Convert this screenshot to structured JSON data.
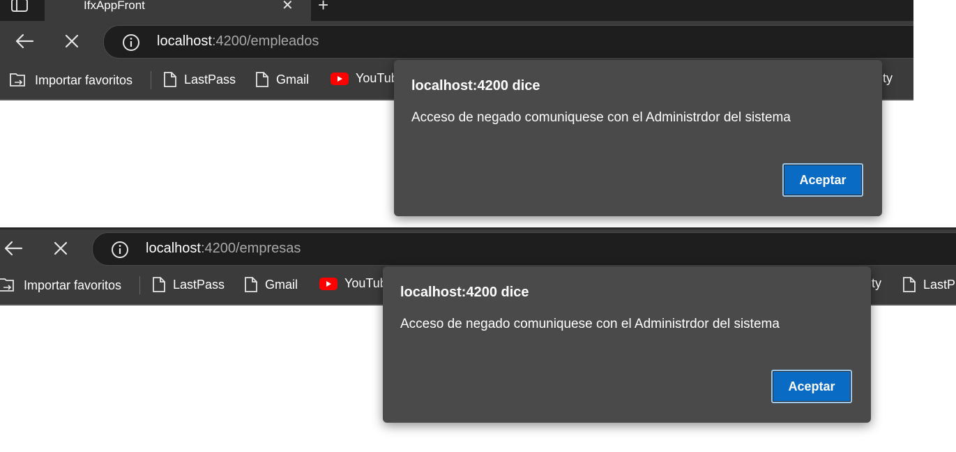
{
  "screen1": {
    "tab": {
      "title": "IfxAppFront"
    },
    "address": {
      "host": "localhost",
      "path": ":4200/empleados"
    },
    "bookmarks": [
      {
        "label": "Importar favoritos",
        "icon": "import-favorites-icon"
      },
      {
        "label": "LastPass",
        "icon": "page-icon"
      },
      {
        "label": "Gmail",
        "icon": "page-icon"
      },
      {
        "label": "YouTube",
        "icon": "youtube-icon"
      },
      {
        "label": "ity",
        "icon": ""
      }
    ],
    "dialog": {
      "title": "localhost:4200 dice",
      "message": "Acceso de negado comuniquese con el Administrdor del sistema",
      "ok_label": "Aceptar"
    }
  },
  "screen2": {
    "address": {
      "host": "localhost",
      "path": ":4200/empresas"
    },
    "bookmarks": [
      {
        "label": "Importar favoritos",
        "icon": "import-favorites-icon"
      },
      {
        "label": "LastPass",
        "icon": "page-icon"
      },
      {
        "label": "Gmail",
        "icon": "page-icon"
      },
      {
        "label": "YouTube",
        "icon": "youtube-icon"
      },
      {
        "label": "ity",
        "icon": ""
      },
      {
        "label": "LastP",
        "icon": "page-icon"
      }
    ],
    "dialog": {
      "title": "localhost:4200 dice",
      "message": "Acceso de negado comuniquese con el Administrdor del sistema",
      "ok_label": "Aceptar"
    }
  },
  "colors": {
    "chrome": "#3b3b3b",
    "dialog": "#4a4a4a",
    "accent": "#0a6bc4"
  }
}
